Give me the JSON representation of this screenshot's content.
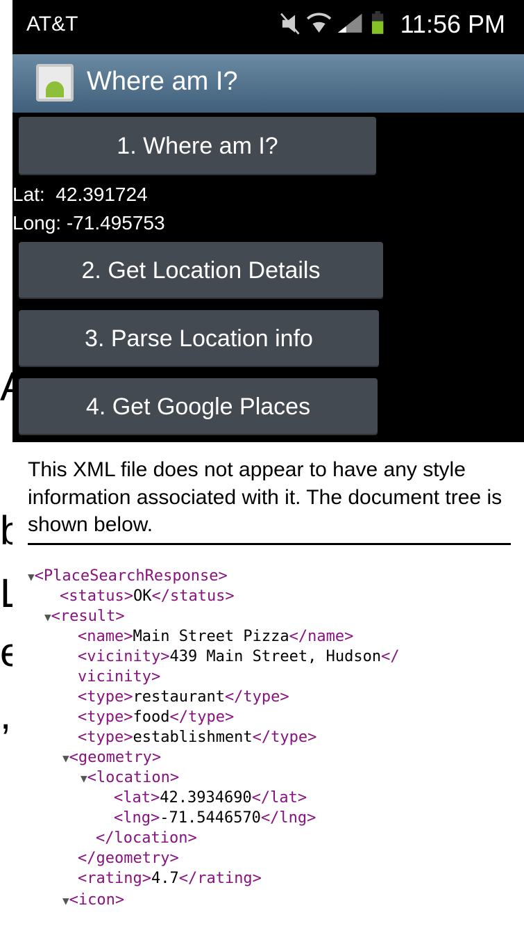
{
  "status_bar": {
    "carrier": "AT&T",
    "time": "11:56 PM"
  },
  "app": {
    "title": "Where am I?"
  },
  "buttons": {
    "b1": "1. Where am I?",
    "b2": "2. Get Location Details",
    "b3": "3. Parse Location info",
    "b4": "4. Get Google Places"
  },
  "coords": {
    "lat": "Lat:  42.391724",
    "long": "Long: -71.495753"
  },
  "web": {
    "notice": "This XML file does not appear to have any style information associated with it. The document tree is shown below.",
    "xml": {
      "root_open": "<PlaceSearchResponse>",
      "status_open": "<status>",
      "status_value": "OK",
      "status_close": "</status>",
      "result_open": "<result>",
      "name_open": "<name>",
      "name_value": "Main Street Pizza",
      "name_close": "</name>",
      "vicinity_open": "<vicinity>",
      "vicinity_value": "439 Main Street, Hudson",
      "vicinity_close_a": "</",
      "vicinity_close_b": "vicinity>",
      "type_open": "<type>",
      "type_close": "</type>",
      "type1": "restaurant",
      "type2": "food",
      "type3": "establishment",
      "geometry_open": "<geometry>",
      "location_open": "<location>",
      "lat_open": "<lat>",
      "lat_value": "42.3934690",
      "lat_close": "</lat>",
      "lng_open": "<lng>",
      "lng_value": "-71.5446570",
      "lng_close": "</lng>",
      "location_close": "</location>",
      "geometry_close": "</geometry>",
      "rating_open": "<rating>",
      "rating_value": "4.7",
      "rating_close": "</rating>",
      "icon_open": "<icon>"
    }
  },
  "background_slide": {
    "frag1": "A",
    "frag2": "b",
    "frag3": "L",
    "frag4": "e",
    "frag5": ","
  }
}
